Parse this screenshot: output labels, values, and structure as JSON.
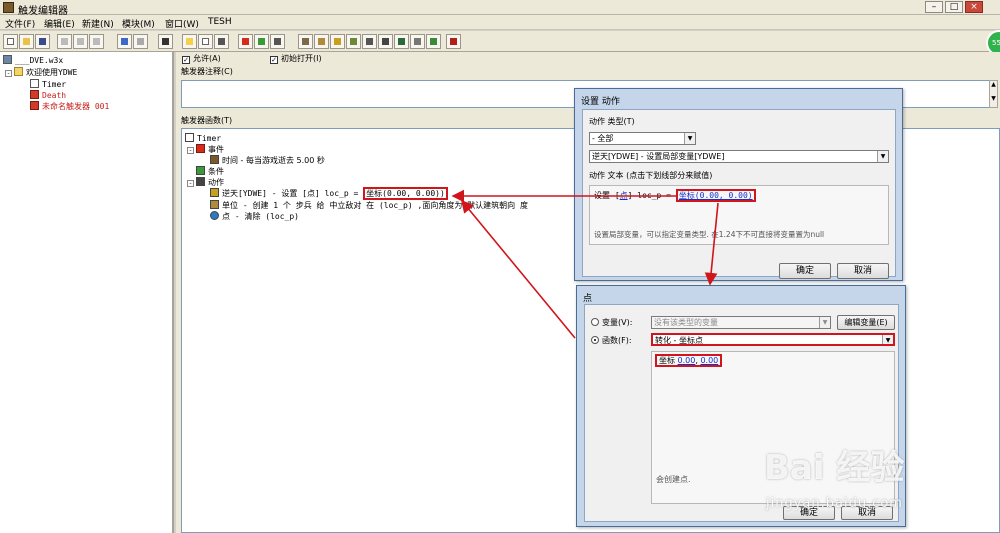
{
  "window": {
    "title": "触发编辑器"
  },
  "menu": [
    "文件(F)",
    "编辑(E)",
    "新建(N)",
    "模块(M)",
    "窗口(W)",
    "TESH"
  ],
  "badge": "55",
  "tree": {
    "map": "___DVE.w3x",
    "root": "欢迎使用YDWE",
    "items": [
      "Timer",
      "Death",
      "未命名触发器 001"
    ]
  },
  "panel": {
    "enabled_label": "允许(A)",
    "initially_on_label": "初始打开(I)",
    "comment_label": "触发器注释(C)",
    "functions_label": "触发器函数(T)",
    "func_tree": {
      "name": "Timer",
      "events": "事件",
      "event_item": "时间 - 每当游戏逝去 5.00 秒",
      "conditions": "条件",
      "actions": "动作",
      "action_1": "逆天[YDWE] - 设置 [点] loc_p = ",
      "action_1_value": "坐标(0.00, 0.00))",
      "action_2": "单位 - 创建 1 个 步兵 给 中立敌对 在 (loc_p) ,面向角度为 默认建筑朝向 度",
      "action_3": "点 - 清除 (loc_p)"
    }
  },
  "dialog_action": {
    "title": "设置 动作",
    "type_label": "动作 类型(T)",
    "type_value": "- 全部",
    "action_value": "逆天[YDWE] - 设置局部变量[YDWE]",
    "text_label": "动作 文本 (点击下划线部分来赋值)",
    "text_prefix": "设置 [",
    "text_link1": "点",
    "text_middle": "] loc_p = ",
    "text_link2": "坐标(0.00, 0.00)",
    "description": "设置局部变量，可以指定变量类型. 在1.24下不可直接将变量置为null",
    "ok": "确定",
    "cancel": "取消"
  },
  "dialog_point": {
    "title": "点",
    "variable_label": "变量(V):",
    "variable_value": "没有该类型的变量",
    "edit_variable": "编辑变量(E)",
    "function_label": "函数(F):",
    "function_value": "转化 - 坐标点",
    "coord_label": "坐标 ",
    "coord_x": "0.00",
    "coord_sep": ", ",
    "coord_y": "0.00",
    "hint": "会创建点.",
    "ok": "确定",
    "cancel": "取消"
  },
  "watermark": {
    "main": "Bai 经验",
    "url": "jingyan.baidu.com"
  },
  "colors": {
    "annotation": "#d0151c",
    "link": "#1530c8",
    "dialog_frame": "#c5d6ea"
  }
}
